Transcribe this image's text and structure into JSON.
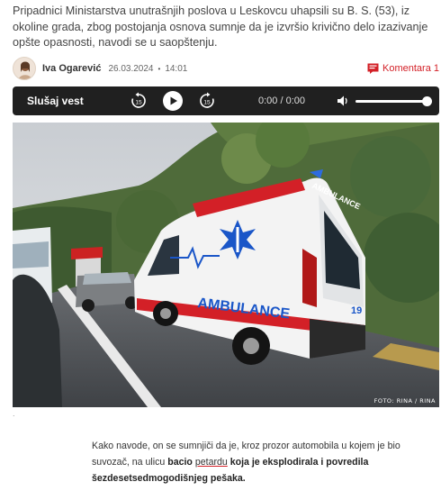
{
  "article": {
    "lead": "Pripadnici Ministarstva unutrašnjih poslova u Leskovcu uhapsili su B. S. (53), iz okoline grada, zbog postojanja osnova sumnje da je izvršio krivično delo izazivanje opšte opasnosti, navodi se u saopštenju.",
    "author": "Iva Ogarević",
    "date": "26.03.2024",
    "separator": "•",
    "time": "14:01",
    "comments_label": "Komentara 1",
    "body_part1": "Kako navode, on se sumnjiči da je, kroz prozor automobila u kojem je bio suvozač, na ulicu ",
    "body_bold1": "bacio ",
    "body_link": "petardu",
    "body_bold2": " koja je eksplodirala i povredila šezdesetsedmogodišnjeg pešaka."
  },
  "player": {
    "title": "Slušaj vest",
    "rewind_label": "15",
    "forward_label": "15",
    "current_time": "0:00",
    "time_separator": "/",
    "duration": "0:00",
    "volume_level": 1.0
  },
  "photo": {
    "credit": "FOTO: RINA / RINA",
    "vehicle_text_side": "AMBULANCE",
    "vehicle_text_roof": "AMBULANCE",
    "vehicle_number": "19"
  },
  "colors": {
    "accent": "#d32027",
    "player_bg": "#202020",
    "ambulance_blue": "#1a56c8"
  },
  "icons": {
    "comments": "comment-bubble-icon",
    "rewind": "rewind-15-icon",
    "play": "play-icon",
    "forward": "forward-15-icon",
    "volume": "volume-icon"
  }
}
